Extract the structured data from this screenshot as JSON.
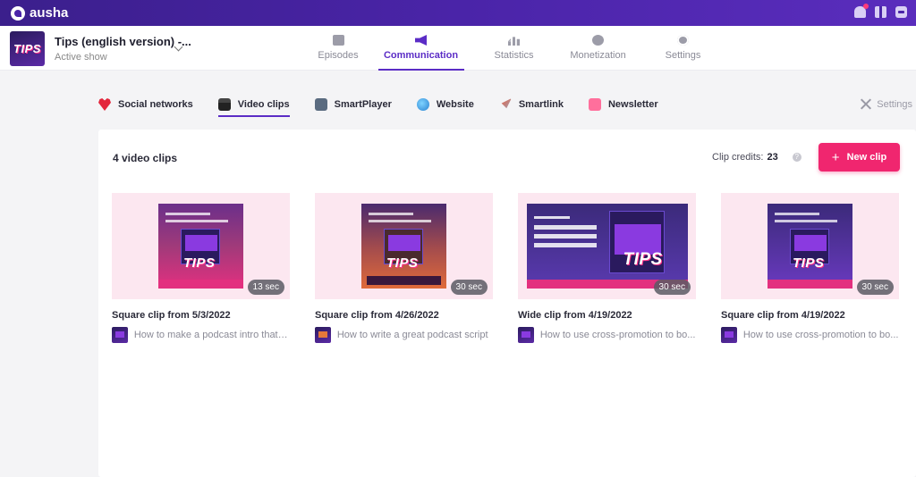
{
  "app": {
    "brand": "ausha"
  },
  "show": {
    "title": "Tips (english version) -...",
    "status": "Active show",
    "thumb_text": "TIPS"
  },
  "mainnav": [
    {
      "label": "Episodes",
      "icon": "episodes-icon",
      "active": false
    },
    {
      "label": "Communication",
      "icon": "megaphone-icon",
      "active": true
    },
    {
      "label": "Statistics",
      "icon": "stats-icon",
      "active": false
    },
    {
      "label": "Monetization",
      "icon": "money-icon",
      "active": false
    },
    {
      "label": "Settings",
      "icon": "gear-icon",
      "active": false
    }
  ],
  "subnav": [
    {
      "label": "Social networks",
      "icon": "heart-icon",
      "active": false
    },
    {
      "label": "Video clips",
      "icon": "clapperboard-icon",
      "active": true
    },
    {
      "label": "SmartPlayer",
      "icon": "play-icon",
      "active": false
    },
    {
      "label": "Website",
      "icon": "globe-icon",
      "active": false
    },
    {
      "label": "Smartlink",
      "icon": "rocket-icon",
      "active": false
    },
    {
      "label": "Newsletter",
      "icon": "mail-icon",
      "active": false
    }
  ],
  "subnav_settings": "Settings",
  "panel": {
    "count": "4 video clips",
    "credits_label": "Clip credits:",
    "credits_value": "23",
    "help": "?",
    "new_clip": "New clip",
    "plus": "+"
  },
  "clips": [
    {
      "title": "Square clip from 5/3/2022",
      "duration": "13 sec",
      "episode": "How to make a podcast intro that r...",
      "thumb_text": "TIPS",
      "format": "square"
    },
    {
      "title": "Square clip from 4/26/2022",
      "duration": "30 sec",
      "episode": "How to write a great podcast script",
      "thumb_text": "TIPS",
      "format": "square"
    },
    {
      "title": "Wide clip from 4/19/2022",
      "duration": "30 sec",
      "episode": "How to use cross-promotion to bo...",
      "thumb_text": "TIPS",
      "format": "wide"
    },
    {
      "title": "Square clip from 4/19/2022",
      "duration": "30 sec",
      "episode": "How to use cross-promotion to bo...",
      "thumb_text": "TIPS",
      "format": "square"
    }
  ],
  "colors": {
    "accent": "#5b2cc6",
    "cta": "#f0266f",
    "topbar": "#4a24a8"
  }
}
